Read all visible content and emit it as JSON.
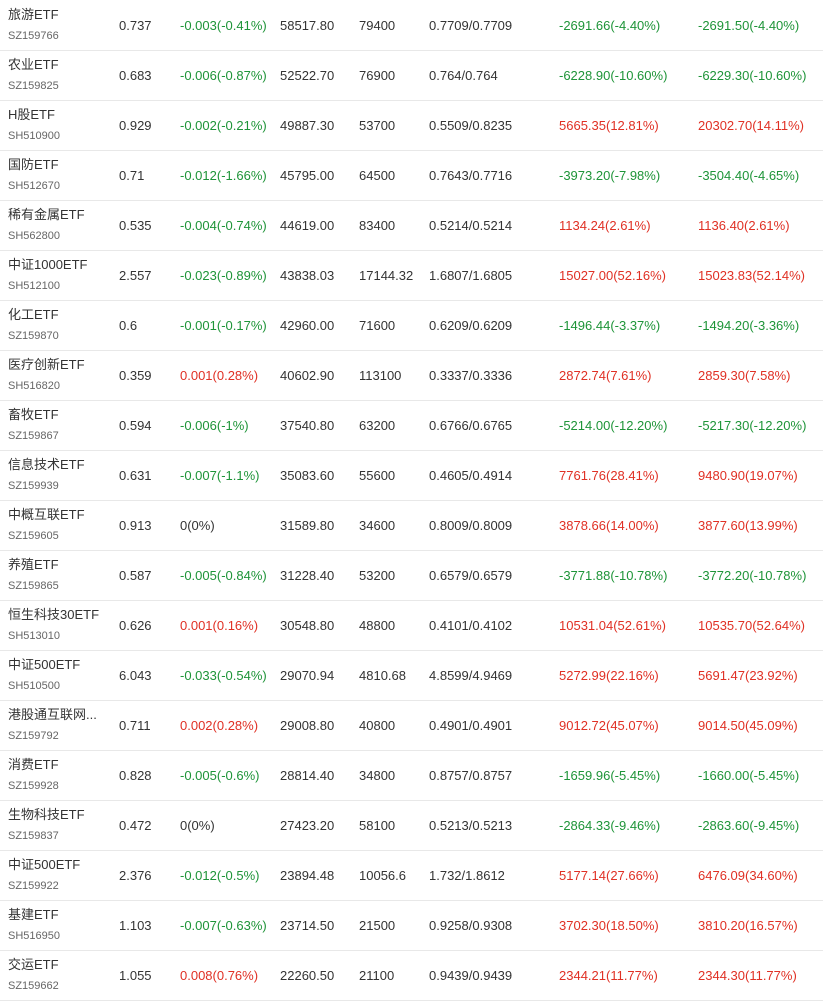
{
  "colors": {
    "up": "#e03024",
    "down": "#1e9438",
    "flat": "#333333"
  },
  "rows": [
    {
      "name": "旅游ETF",
      "code": "SZ159766",
      "price": "0.737",
      "change": "-0.003(-0.41%)",
      "dir": "down",
      "amount": "58517.80",
      "shares": "79400",
      "cost": "0.7709/0.7709",
      "pl1": "-2691.66(-4.40%)",
      "pl1_dir": "down",
      "pl2": "-2691.50(-4.40%)",
      "pl2_dir": "down"
    },
    {
      "name": "农业ETF",
      "code": "SZ159825",
      "price": "0.683",
      "change": "-0.006(-0.87%)",
      "dir": "down",
      "amount": "52522.70",
      "shares": "76900",
      "cost": "0.764/0.764",
      "pl1": "-6228.90(-10.60%)",
      "pl1_dir": "down",
      "pl2": "-6229.30(-10.60%)",
      "pl2_dir": "down"
    },
    {
      "name": "H股ETF",
      "code": "SH510900",
      "price": "0.929",
      "change": "-0.002(-0.21%)",
      "dir": "down",
      "amount": "49887.30",
      "shares": "53700",
      "cost": "0.5509/0.8235",
      "pl1": "5665.35(12.81%)",
      "pl1_dir": "up",
      "pl2": "20302.70(14.11%)",
      "pl2_dir": "up"
    },
    {
      "name": "国防ETF",
      "code": "SH512670",
      "price": "0.71",
      "change": "-0.012(-1.66%)",
      "dir": "down",
      "amount": "45795.00",
      "shares": "64500",
      "cost": "0.7643/0.7716",
      "pl1": "-3973.20(-7.98%)",
      "pl1_dir": "down",
      "pl2": "-3504.40(-4.65%)",
      "pl2_dir": "down"
    },
    {
      "name": "稀有金属ETF",
      "code": "SH562800",
      "price": "0.535",
      "change": "-0.004(-0.74%)",
      "dir": "down",
      "amount": "44619.00",
      "shares": "83400",
      "cost": "0.5214/0.5214",
      "pl1": "1134.24(2.61%)",
      "pl1_dir": "up",
      "pl2": "1136.40(2.61%)",
      "pl2_dir": "up"
    },
    {
      "name": "中证1000ETF",
      "code": "SH512100",
      "price": "2.557",
      "change": "-0.023(-0.89%)",
      "dir": "down",
      "amount": "43838.03",
      "shares": "17144.32",
      "cost": "1.6807/1.6805",
      "pl1": "15027.00(52.16%)",
      "pl1_dir": "up",
      "pl2": "15023.83(52.14%)",
      "pl2_dir": "up"
    },
    {
      "name": "化工ETF",
      "code": "SZ159870",
      "price": "0.6",
      "change": "-0.001(-0.17%)",
      "dir": "down",
      "amount": "42960.00",
      "shares": "71600",
      "cost": "0.6209/0.6209",
      "pl1": "-1496.44(-3.37%)",
      "pl1_dir": "down",
      "pl2": "-1494.20(-3.36%)",
      "pl2_dir": "down"
    },
    {
      "name": "医疗创新ETF",
      "code": "SH516820",
      "price": "0.359",
      "change": "0.001(0.28%)",
      "dir": "up",
      "amount": "40602.90",
      "shares": "113100",
      "cost": "0.3337/0.3336",
      "pl1": "2872.74(7.61%)",
      "pl1_dir": "up",
      "pl2": "2859.30(7.58%)",
      "pl2_dir": "up"
    },
    {
      "name": "畜牧ETF",
      "code": "SZ159867",
      "price": "0.594",
      "change": "-0.006(-1%)",
      "dir": "down",
      "amount": "37540.80",
      "shares": "63200",
      "cost": "0.6766/0.6765",
      "pl1": "-5214.00(-12.20%)",
      "pl1_dir": "down",
      "pl2": "-5217.30(-12.20%)",
      "pl2_dir": "down"
    },
    {
      "name": "信息技术ETF",
      "code": "SZ159939",
      "price": "0.631",
      "change": "-0.007(-1.1%)",
      "dir": "down",
      "amount": "35083.60",
      "shares": "55600",
      "cost": "0.4605/0.4914",
      "pl1": "7761.76(28.41%)",
      "pl1_dir": "up",
      "pl2": "9480.90(19.07%)",
      "pl2_dir": "up"
    },
    {
      "name": "中概互联ETF",
      "code": "SZ159605",
      "price": "0.913",
      "change": "0(0%)",
      "dir": "flat",
      "amount": "31589.80",
      "shares": "34600",
      "cost": "0.8009/0.8009",
      "pl1": "3878.66(14.00%)",
      "pl1_dir": "up",
      "pl2": "3877.60(13.99%)",
      "pl2_dir": "up"
    },
    {
      "name": "养殖ETF",
      "code": "SZ159865",
      "price": "0.587",
      "change": "-0.005(-0.84%)",
      "dir": "down",
      "amount": "31228.40",
      "shares": "53200",
      "cost": "0.6579/0.6579",
      "pl1": "-3771.88(-10.78%)",
      "pl1_dir": "down",
      "pl2": "-3772.20(-10.78%)",
      "pl2_dir": "down"
    },
    {
      "name": "恒生科技30ETF",
      "code": "SH513010",
      "price": "0.626",
      "change": "0.001(0.16%)",
      "dir": "up",
      "amount": "30548.80",
      "shares": "48800",
      "cost": "0.4101/0.4102",
      "pl1": "10531.04(52.61%)",
      "pl1_dir": "up",
      "pl2": "10535.70(52.64%)",
      "pl2_dir": "up"
    },
    {
      "name": "中证500ETF",
      "code": "SH510500",
      "price": "6.043",
      "change": "-0.033(-0.54%)",
      "dir": "down",
      "amount": "29070.94",
      "shares": "4810.68",
      "cost": "4.8599/4.9469",
      "pl1": "5272.99(22.16%)",
      "pl1_dir": "up",
      "pl2": "5691.47(23.92%)",
      "pl2_dir": "up"
    },
    {
      "name": "港股通互联网...",
      "code": "SZ159792",
      "price": "0.711",
      "change": "0.002(0.28%)",
      "dir": "up",
      "amount": "29008.80",
      "shares": "40800",
      "cost": "0.4901/0.4901",
      "pl1": "9012.72(45.07%)",
      "pl1_dir": "up",
      "pl2": "9014.50(45.09%)",
      "pl2_dir": "up"
    },
    {
      "name": "消费ETF",
      "code": "SZ159928",
      "price": "0.828",
      "change": "-0.005(-0.6%)",
      "dir": "down",
      "amount": "28814.40",
      "shares": "34800",
      "cost": "0.8757/0.8757",
      "pl1": "-1659.96(-5.45%)",
      "pl1_dir": "down",
      "pl2": "-1660.00(-5.45%)",
      "pl2_dir": "down"
    },
    {
      "name": "生物科技ETF",
      "code": "SZ159837",
      "price": "0.472",
      "change": "0(0%)",
      "dir": "flat",
      "amount": "27423.20",
      "shares": "58100",
      "cost": "0.5213/0.5213",
      "pl1": "-2864.33(-9.46%)",
      "pl1_dir": "down",
      "pl2": "-2863.60(-9.45%)",
      "pl2_dir": "down"
    },
    {
      "name": "中证500ETF",
      "code": "SZ159922",
      "price": "2.376",
      "change": "-0.012(-0.5%)",
      "dir": "down",
      "amount": "23894.48",
      "shares": "10056.6",
      "cost": "1.732/1.8612",
      "pl1": "5177.14(27.66%)",
      "pl1_dir": "up",
      "pl2": "6476.09(34.60%)",
      "pl2_dir": "up"
    },
    {
      "name": "基建ETF",
      "code": "SH516950",
      "price": "1.103",
      "change": "-0.007(-0.63%)",
      "dir": "down",
      "amount": "23714.50",
      "shares": "21500",
      "cost": "0.9258/0.9308",
      "pl1": "3702.30(18.50%)",
      "pl1_dir": "up",
      "pl2": "3810.20(16.57%)",
      "pl2_dir": "up"
    },
    {
      "name": "交运ETF",
      "code": "SZ159662",
      "price": "1.055",
      "change": "0.008(0.76%)",
      "dir": "up",
      "amount": "22260.50",
      "shares": "21100",
      "cost": "0.9439/0.9439",
      "pl1": "2344.21(11.77%)",
      "pl1_dir": "up",
      "pl2": "2344.30(11.77%)",
      "pl2_dir": "up"
    }
  ]
}
